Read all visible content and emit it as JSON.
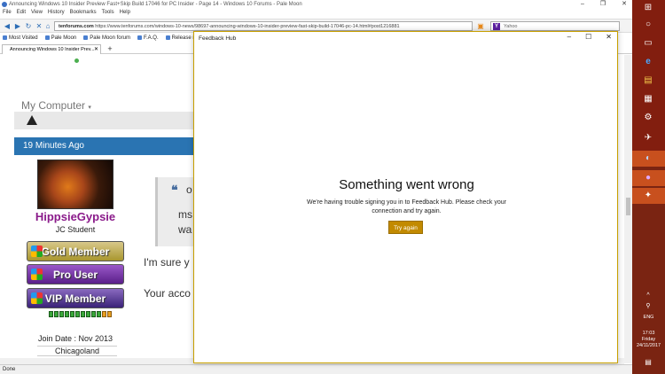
{
  "browser": {
    "title": "Announcing Windows 10 Insider Preview Fast+Skip Build 17046 for PC Insider - Page 14 - Windows 10 Forums - Pale Moon",
    "menu": [
      "File",
      "Edit",
      "View",
      "History",
      "Bookmarks",
      "Tools",
      "Help"
    ],
    "url_domain": "tenforums.com",
    "url_rest": "https://www.tenforums.com/windows-10-news/98697-announcing-windows-10-insider-preview-fast-skip-build-17046-pc-14.html#post1216881",
    "search_placeholder": "Yahoo",
    "bookmarks": [
      "Most Visited",
      "Pale Moon",
      "Pale Moon forum",
      "F.A.Q.",
      "Release notes"
    ],
    "tab_label": "Announcing Windows 10 Insider Prev...",
    "status": "Done"
  },
  "page": {
    "my_computer": "My Computer",
    "post_time": "19 Minutes Ago",
    "username": "HippsieGypsie",
    "user_title": "JC Student",
    "badges": [
      "Gold Member",
      "Pro User",
      "VIP Member"
    ],
    "join_date": "Join Date : Nov 2013",
    "location": "Chicagoland",
    "quote_line1": "o",
    "quote_line2": "ms",
    "quote_line3": "wa",
    "post_line1": "I'm sure y",
    "post_line2": "Your acco"
  },
  "dialog": {
    "title": "Feedback Hub",
    "heading": "Something went wrong",
    "message": "We're having trouble signing you in to Feedback Hub. Please check your connection and try again.",
    "button": "Try again"
  },
  "taskbar": {
    "language": "ENG",
    "time": "17:03",
    "day": "Friday",
    "date": "24/11/2017"
  },
  "colors": {
    "accent_blue": "#2a74b2",
    "taskbar": "#7a2412",
    "try_again": "#c28a00",
    "username": "#8a1a8a"
  }
}
